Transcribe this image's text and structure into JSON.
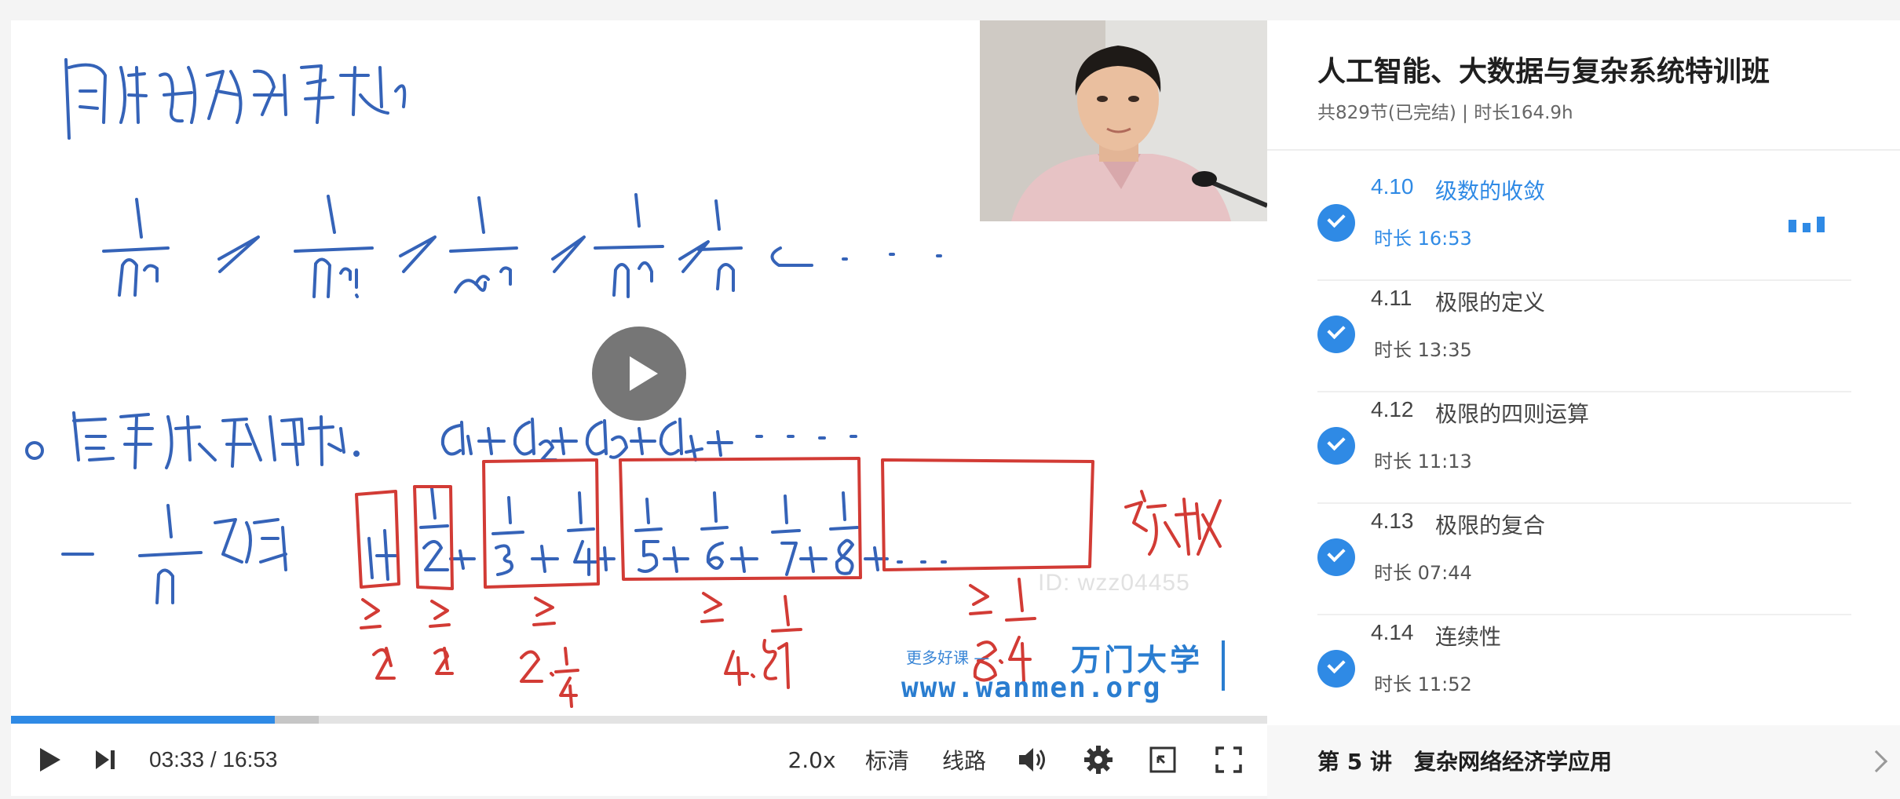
{
  "player": {
    "current_time": "03:33",
    "separator": "/",
    "duration": "16:53",
    "progress_fraction": 0.21,
    "buffered_fraction": 0.245,
    "speed": "2.0x",
    "quality": "标清",
    "route": "线路",
    "watermark_id": "ID: wzz04455",
    "brand_tagline": "更多好课 —",
    "brand_name": "万门大学",
    "brand_url": "www.wanmen.org",
    "icons": {
      "play": "play-icon",
      "next": "next-icon",
      "volume": "volume-icon",
      "settings": "gear-icon",
      "pip": "picture-in-picture-icon",
      "fullscreen": "fullscreen-icon"
    }
  },
  "course": {
    "title": "人工智能、大数据与复杂系统特训班",
    "meta": "共829节(已完结) | 时长164.9h"
  },
  "lessons": [
    {
      "num": "4.10",
      "name": "级数的收敛",
      "duration": "时长 16:53",
      "active": true
    },
    {
      "num": "4.11",
      "name": "极限的定义",
      "duration": "时长 13:35",
      "active": false
    },
    {
      "num": "4.12",
      "name": "极限的四则运算",
      "duration": "时长 11:13",
      "active": false
    },
    {
      "num": "4.13",
      "name": "极限的复合",
      "duration": "时长 07:44",
      "active": false
    },
    {
      "num": "4.14",
      "name": "连续性",
      "duration": "时长 11:52",
      "active": false
    }
  ],
  "chapter": {
    "label": "第 5 讲　复杂网络经济学应用"
  },
  "colors": {
    "accent": "#2f8ae5",
    "ink_blue": "#3563b8",
    "ink_red": "#d23b35"
  }
}
